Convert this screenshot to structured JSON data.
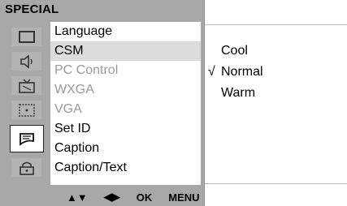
{
  "title": "SPECIAL",
  "sidebar": {
    "icons": [
      {
        "name": "picture-icon"
      },
      {
        "name": "sound-icon"
      },
      {
        "name": "tv-icon"
      },
      {
        "name": "screen-icon"
      },
      {
        "name": "special-icon"
      },
      {
        "name": "lock-icon"
      }
    ],
    "active_index": 4
  },
  "menu": {
    "items": [
      {
        "label": "Language",
        "state": "normal"
      },
      {
        "label": "CSM",
        "state": "selected"
      },
      {
        "label": "PC Control",
        "state": "disabled"
      },
      {
        "label": "WXGA",
        "state": "disabled"
      },
      {
        "label": "VGA",
        "state": "disabled"
      },
      {
        "label": "Set ID",
        "state": "normal"
      },
      {
        "label": "Caption",
        "state": "normal"
      },
      {
        "label": "Caption/Text",
        "state": "normal"
      }
    ]
  },
  "submenu": {
    "options": [
      {
        "label": "Cool",
        "checked": false
      },
      {
        "label": "Normal",
        "checked": true
      },
      {
        "label": "Warm",
        "checked": false
      }
    ],
    "check_mark": "√"
  },
  "bottom_bar": {
    "updown": "▲▼",
    "leftright": "◀▶",
    "ok": "OK",
    "menu": "MENU"
  }
}
